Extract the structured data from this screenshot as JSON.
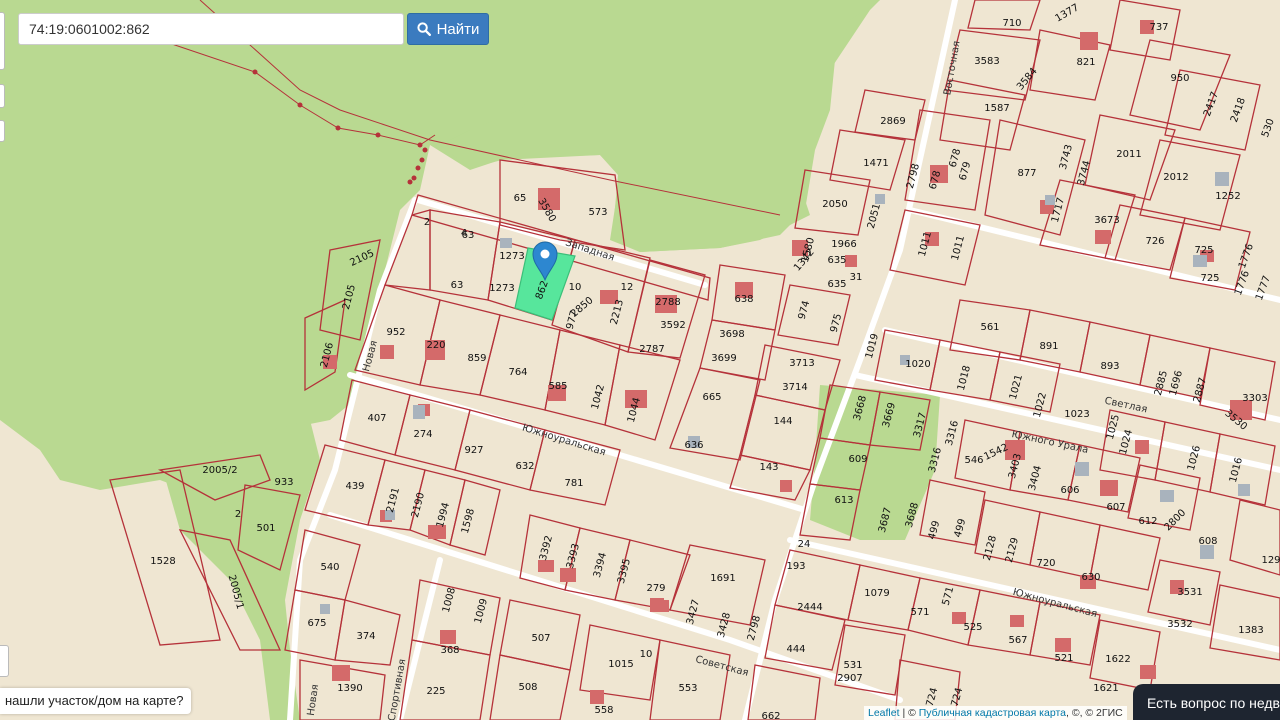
{
  "search": {
    "value": "74:19:0601002:862",
    "button_label": "Найти",
    "icon": "search-icon"
  },
  "bottom_note": "нашли участок/дом на карте?",
  "chat": {
    "label": "Есть вопрос по недв"
  },
  "attribution": {
    "leaflet": "Leaflet",
    "sep1": " | © ",
    "cadastre": "Публичная кадастровая карта",
    "rest": ", ©, © 2ГИС"
  },
  "colors": {
    "parcel_border": "#b5323a",
    "parcel_fill": "#efe6d2",
    "green_area": "#b9d991",
    "selected_parcel": "#57e69c",
    "marker": "#2d87d0"
  },
  "streets": [
    {
      "name": "Западная"
    },
    {
      "name": "Южноуральская"
    },
    {
      "name": "Южноуральская"
    },
    {
      "name": "Советская"
    },
    {
      "name": "Светлая"
    },
    {
      "name": "Южного Урала"
    },
    {
      "name": "Восточная"
    },
    {
      "name": "Новая"
    },
    {
      "name": "Спортивная"
    },
    {
      "name": "Новая"
    }
  ],
  "parcels": [
    "65",
    "3580",
    "573",
    "2",
    "63",
    "4",
    "1273",
    "1273",
    "862",
    "10",
    "12",
    "2850",
    "2788",
    "3592",
    "2787",
    "977",
    "2213",
    "63",
    "952",
    "220",
    "859",
    "764",
    "585",
    "1042",
    "1044",
    "407",
    "274",
    "927",
    "632",
    "781",
    "439",
    "2191",
    "2190",
    "1994",
    "1598",
    "3392",
    "3393",
    "3394",
    "3395",
    "279",
    "1691",
    "3427",
    "3428",
    "540",
    "675",
    "374",
    "1390",
    "1008",
    "1009",
    "368",
    "225",
    "507",
    "508",
    "1015",
    "553",
    "558",
    "10",
    "2105",
    "2105",
    "2106",
    "2005/2",
    "933",
    "501",
    "1528",
    "2005/1",
    "2",
    "638",
    "3698",
    "3699",
    "665",
    "636",
    "3713",
    "3714",
    "144",
    "143",
    "974",
    "975",
    "1019",
    "1342",
    "1580",
    "1966",
    "635",
    "635",
    "31",
    "2050",
    "2051",
    "2869",
    "1471",
    "678",
    "678",
    "679",
    "2798",
    "710",
    "1377",
    "3583",
    "3584",
    "1587",
    "821",
    "737",
    "950",
    "2417",
    "2418",
    "530",
    "877",
    "3743",
    "3744",
    "2011",
    "2012",
    "1252",
    "1717",
    "3673",
    "726",
    "725",
    "1776",
    "725",
    "1776",
    "1777",
    "1011",
    "1011",
    "561",
    "891",
    "893",
    "1020",
    "1018",
    "1021",
    "1022",
    "1023",
    "1025",
    "2885",
    "1696",
    "2887",
    "3303",
    "3530",
    "1024",
    "1026",
    "1016",
    "3668",
    "3669",
    "3317",
    "3316",
    "609",
    "3316",
    "546",
    "1542",
    "3403",
    "3404",
    "606",
    "607",
    "612",
    "2800",
    "608",
    "129",
    "613",
    "3687",
    "3688",
    "499",
    "499",
    "2128",
    "2129",
    "720",
    "630",
    "3531",
    "3532",
    "1383",
    "193",
    "1079",
    "571",
    "571",
    "525",
    "567",
    "521",
    "1622",
    "1621",
    "2444",
    "444",
    "531",
    "2907",
    "2798",
    "24",
    "724",
    "724",
    "662"
  ]
}
